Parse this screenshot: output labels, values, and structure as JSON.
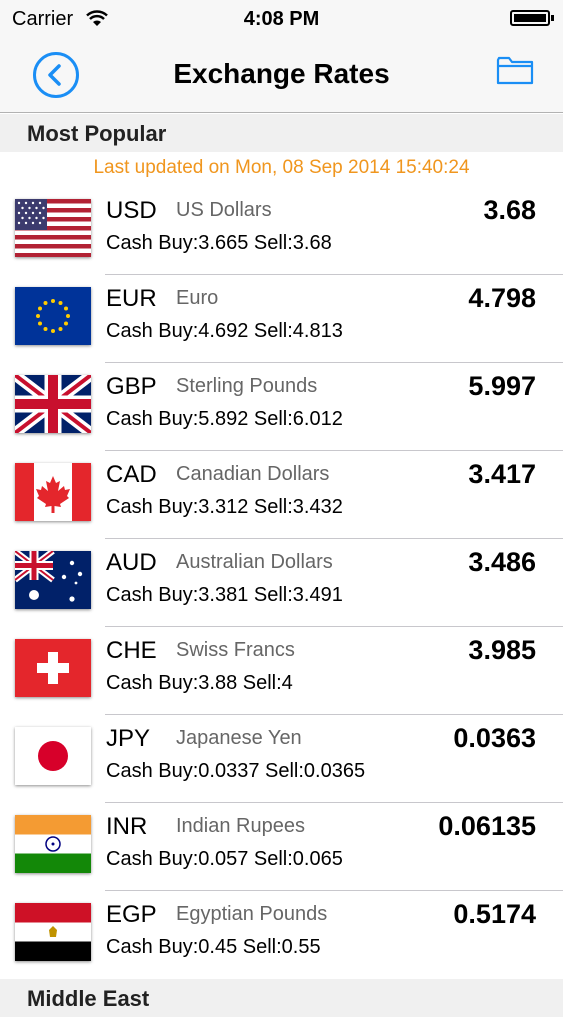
{
  "status_bar": {
    "carrier": "Carrier",
    "time": "4:08 PM"
  },
  "nav": {
    "title": "Exchange Rates",
    "back_icon": "back-circle-icon",
    "folder_icon": "folder-icon"
  },
  "section": {
    "title": "Most Popular"
  },
  "updated": "Last updated on Mon, 08 Sep 2014 15:40:24",
  "rates": [
    {
      "code": "USD",
      "name": "US Dollars",
      "rate": "3.68",
      "cash": "Cash Buy:3.665 Sell:3.68",
      "flag": "us-flag-icon"
    },
    {
      "code": "EUR",
      "name": "Euro",
      "rate": "4.798",
      "cash": "Cash Buy:4.692 Sell:4.813",
      "flag": "eu-flag-icon"
    },
    {
      "code": "GBP",
      "name": "Sterling Pounds",
      "rate": "5.997",
      "cash": "Cash Buy:5.892 Sell:6.012",
      "flag": "uk-flag-icon"
    },
    {
      "code": "CAD",
      "name": "Canadian Dollars",
      "rate": "3.417",
      "cash": "Cash Buy:3.312 Sell:3.432",
      "flag": "canada-flag-icon"
    },
    {
      "code": "AUD",
      "name": "Australian Dollars",
      "rate": "3.486",
      "cash": "Cash Buy:3.381 Sell:3.491",
      "flag": "australia-flag-icon"
    },
    {
      "code": "CHE",
      "name": "Swiss Francs",
      "rate": "3.985",
      "cash": "Cash Buy:3.88 Sell:4",
      "flag": "swiss-flag-icon"
    },
    {
      "code": "JPY",
      "name": "Japanese Yen",
      "rate": "0.0363",
      "cash": "Cash Buy:0.0337 Sell:0.0365",
      "flag": "japan-flag-icon"
    },
    {
      "code": "INR",
      "name": "Indian Rupees",
      "rate": "0.06135",
      "cash": "Cash Buy:0.057 Sell:0.065",
      "flag": "india-flag-icon"
    },
    {
      "code": "EGP",
      "name": "Egyptian Pounds",
      "rate": "0.5174",
      "cash": "Cash Buy:0.45 Sell:0.55",
      "flag": "egypt-flag-icon"
    }
  ],
  "next_section": {
    "title": "Middle East"
  },
  "colors": {
    "accent": "#1a8ef5",
    "updated_text": "#f0961e"
  }
}
